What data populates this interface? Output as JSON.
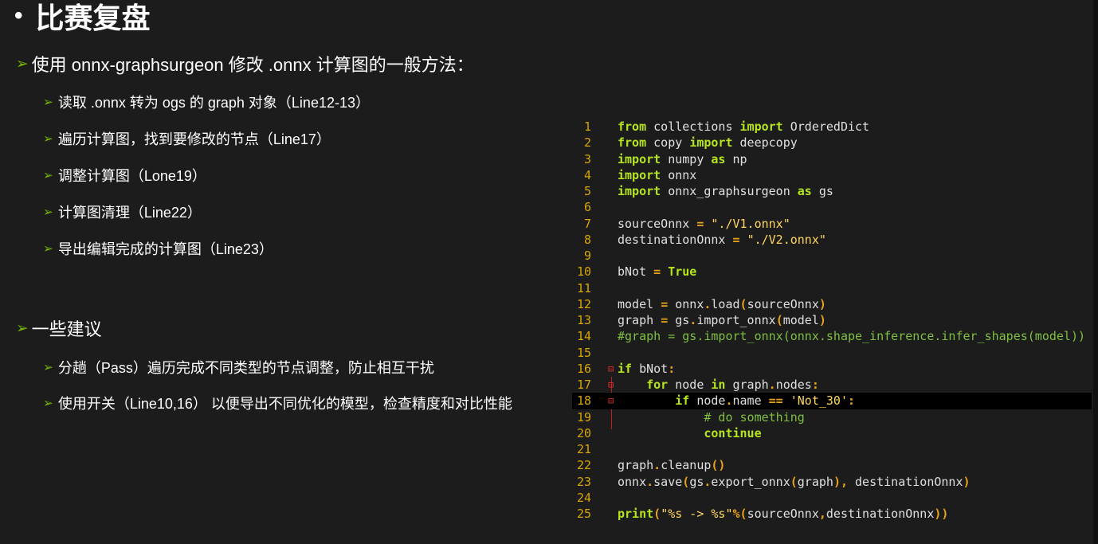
{
  "title": "比赛复盘",
  "bullets": {
    "main1": "使用 onnx-graphsurgeon 修改 .onnx 计算图的一般方法：",
    "sub1": [
      "读取 .onnx 转为 ogs 的 graph 对象（Line12-13）",
      "遍历计算图，找到要修改的节点（Line17）",
      "调整计算图（Lone19）",
      "计算图清理（Line22）",
      "导出编辑完成的计算图（Line23）"
    ],
    "main2": "一些建议",
    "sub2": [
      "分趟（Pass）遍历完成不同类型的节点调整，防止相互干扰",
      "使用开关（Line10,16） 以便导出不同优化的模型，检查精度和对比性能"
    ]
  },
  "code": {
    "highlight_line": 18,
    "lines": [
      "1",
      "2",
      "3",
      "4",
      "5",
      "6",
      "7",
      "8",
      "9",
      "10",
      "11",
      "12",
      "13",
      "14",
      "15",
      "16",
      "17",
      "18",
      "19",
      "20",
      "21",
      "22",
      "23",
      "24",
      "25"
    ],
    "tokens": {
      "from": "from",
      "import": "import",
      "as": "as",
      "in": "in",
      "if": "if",
      "for": "for",
      "continue": "continue",
      "print": "print",
      "True": "True",
      "collections": "collections",
      "OrderedDict": "OrderedDict",
      "copy": "copy",
      "deepcopy": "deepcopy",
      "numpy": "numpy",
      "np": "np",
      "onnx": "onnx",
      "onnx_graphsurgeon": "onnx_graphsurgeon",
      "gs": "gs",
      "sourceOnnx": "sourceOnnx",
      "destinationOnnx": "destinationOnnx",
      "str_v1": "\"./V1.onnx\"",
      "str_v2": "\"./V2.onnx\"",
      "bNot": "bNot",
      "model": "model",
      "load": "load",
      "graph": "graph",
      "import_onnx": "import_onnx",
      "comment14": "#graph = gs.import_onnx(onnx.shape_inference.infer_shapes(model))",
      "node": "node",
      "nodes": "nodes",
      "name": "name",
      "str_not30": "'Not_30'",
      "comment19": "# do something",
      "cleanup": "cleanup",
      "save": "save",
      "export_onnx": "export_onnx",
      "str_fmt": "\"%s -> %s\""
    }
  },
  "colors": {
    "background": "#1c1c1c",
    "bullet_arrow": "#76b900",
    "line_number": "#d7a600",
    "keyword": "#b5e61d",
    "operator": "#e8a317",
    "string": "#ffd75f",
    "comment": "#7fbf3f"
  },
  "icons": {
    "bullet": "arrow-bullet-icon",
    "fold": "fold-marker-icon"
  }
}
